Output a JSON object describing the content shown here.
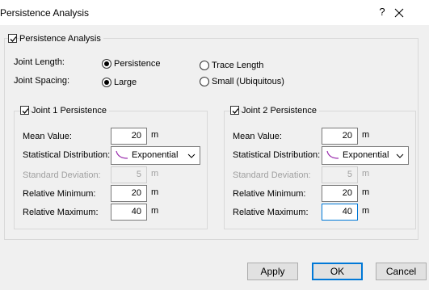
{
  "window": {
    "title": "Persistence Analysis",
    "help": "?",
    "close": "✕"
  },
  "main_check": {
    "label": "Persistence Analysis",
    "checked": true
  },
  "joint_length": {
    "label": "Joint Length:",
    "options": [
      "Persistence",
      "Trace Length"
    ],
    "selected": "Persistence"
  },
  "joint_spacing": {
    "label": "Joint Spacing:",
    "options": [
      "Large",
      "Small (Ubiquitous)"
    ],
    "selected": "Large"
  },
  "joint1": {
    "title": "Joint 1 Persistence",
    "checked": true,
    "mean_label": "Mean Value:",
    "mean": "20",
    "mean_unit": "m",
    "dist_label": "Statistical Distribution:",
    "dist": "Exponential",
    "std_label": "Standard Deviation:",
    "std": "5",
    "std_unit": "m",
    "min_label": "Relative Minimum:",
    "min": "20",
    "min_unit": "m",
    "max_label": "Relative Maximum:",
    "max": "40",
    "max_unit": "m"
  },
  "joint2": {
    "title": "Joint 2 Persistence",
    "checked": true,
    "mean_label": "Mean Value:",
    "mean": "20",
    "mean_unit": "m",
    "dist_label": "Statistical Distribution:",
    "dist": "Exponential",
    "std_label": "Standard Deviation:",
    "std": "5",
    "std_unit": "m",
    "min_label": "Relative Minimum:",
    "min": "20",
    "min_unit": "m",
    "max_label": "Relative Maximum:",
    "max": "40",
    "max_unit": "m"
  },
  "buttons": {
    "apply": "Apply",
    "ok": "OK",
    "cancel": "Cancel"
  },
  "colors": {
    "accent": "#0078d7",
    "dist_icon": "#9b2fae"
  }
}
